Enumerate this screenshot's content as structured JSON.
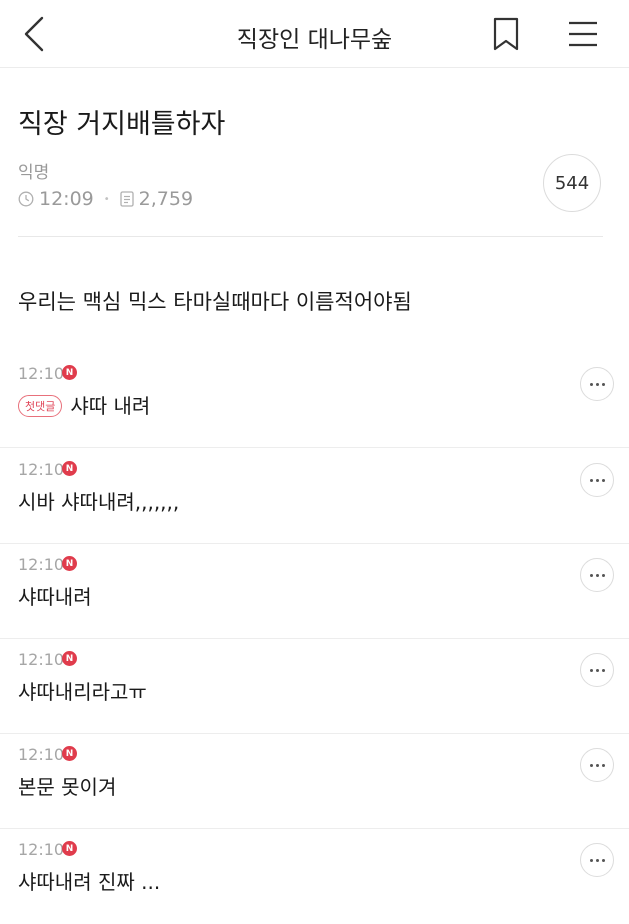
{
  "header": {
    "title": "직장인 대나무숲"
  },
  "post": {
    "title": "직장 거지배틀하자",
    "author": "익명",
    "time": "12:09",
    "views": "2,759",
    "comment_count": "544",
    "body": "우리는 맥심 믹스 타마실때마다 이름적어야됨"
  },
  "new_badge": "N",
  "comments": [
    {
      "time": "12:10",
      "badge": "첫댓글",
      "text": "샤따 내려"
    },
    {
      "time": "12:10",
      "text": "시바 샤따내려,,,,,,,"
    },
    {
      "time": "12:10",
      "text": "샤따내려"
    },
    {
      "time": "12:10",
      "text": "샤따내리라고ㅠ"
    },
    {
      "time": "12:10",
      "text": "본문 못이겨"
    },
    {
      "time": "12:10",
      "text": "샤따내려 진짜 ..."
    }
  ]
}
